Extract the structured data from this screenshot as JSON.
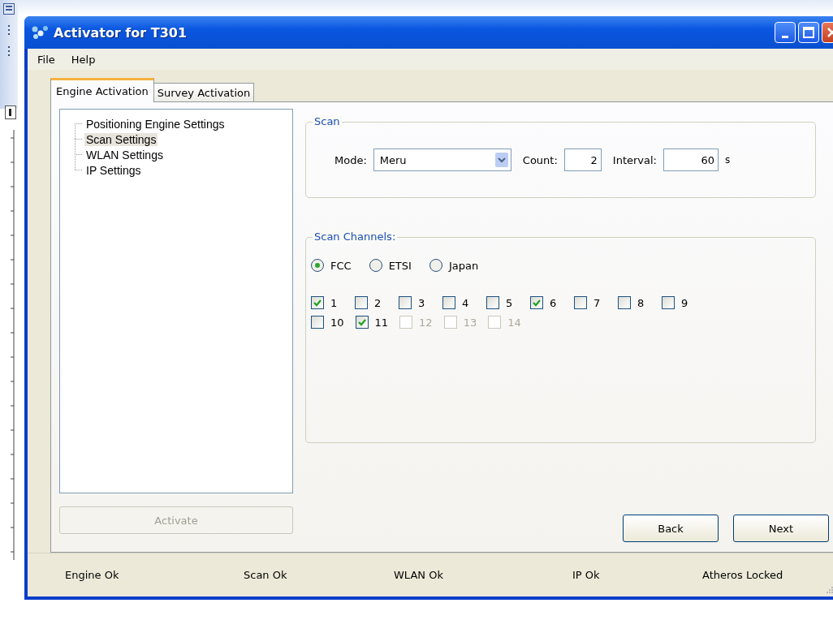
{
  "window": {
    "title": "Activator for T301"
  },
  "menu": [
    "File",
    "Help"
  ],
  "tabs": [
    {
      "label": "Engine Activation",
      "selected": true
    },
    {
      "label": "Survey Activation",
      "selected": false
    }
  ],
  "tree": {
    "items": [
      {
        "label": "Positioning Engine Settings",
        "selected": false
      },
      {
        "label": "Scan Settings",
        "selected": true
      },
      {
        "label": "WLAN Settings",
        "selected": false
      },
      {
        "label": "IP Settings",
        "selected": false
      }
    ]
  },
  "activate_button": {
    "label": "Activate",
    "disabled": true
  },
  "scan_group": {
    "title": "Scan",
    "mode": {
      "label": "Mode:",
      "value": "Meru"
    },
    "count": {
      "label": "Count:",
      "value": "2"
    },
    "interval": {
      "label": "Interval:",
      "value": "60",
      "unit": "s"
    }
  },
  "channels_group": {
    "title": "Scan Channels:",
    "regions": [
      {
        "label": "FCC",
        "selected": true
      },
      {
        "label": "ETSI",
        "selected": false
      },
      {
        "label": "Japan",
        "selected": false
      }
    ],
    "channel_rows": [
      [
        {
          "label": "1",
          "checked": true,
          "disabled": false
        },
        {
          "label": "2",
          "checked": false,
          "disabled": false
        },
        {
          "label": "3",
          "checked": false,
          "disabled": false
        },
        {
          "label": "4",
          "checked": false,
          "disabled": false
        },
        {
          "label": "5",
          "checked": false,
          "disabled": false
        },
        {
          "label": "6",
          "checked": true,
          "disabled": false
        },
        {
          "label": "7",
          "checked": false,
          "disabled": false
        },
        {
          "label": "8",
          "checked": false,
          "disabled": false
        },
        {
          "label": "9",
          "checked": false,
          "disabled": false
        }
      ],
      [
        {
          "label": "10",
          "checked": false,
          "disabled": false
        },
        {
          "label": "11",
          "checked": true,
          "disabled": false
        },
        {
          "label": "12",
          "checked": false,
          "disabled": true
        },
        {
          "label": "13",
          "checked": false,
          "disabled": true
        },
        {
          "label": "14",
          "checked": false,
          "disabled": true
        }
      ]
    ]
  },
  "buttons": [
    "Back",
    "Next"
  ],
  "status_bar": [
    "Engine Ok",
    "Scan Ok",
    "WLAN Ok",
    "IP Ok",
    "Atheros Locked"
  ]
}
